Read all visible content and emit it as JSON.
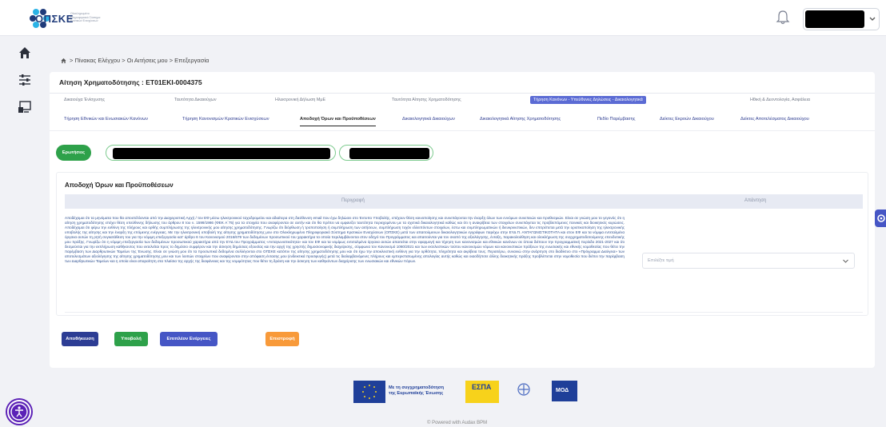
{
  "header": {
    "logo_text": "ΟΠΣΚΕ",
    "logo_subtitle": "Ολοκληρωμένο Πληροφοριακό Σύστημα Κρατικών Ενισχύσεων"
  },
  "breadcrumb": {
    "text": "> Πίνακας Ελέγχου > Οι Αιτήσεις μου > Επεξεργασία"
  },
  "application": {
    "title": "Αίτηση Χρηματοδότησης : ΕΤ01ΕΚΙ-0004375"
  },
  "tabs_level1": [
    "Δικαιούχα Ένίσχυσης",
    "Ταυτότητα Δικαιούχων",
    "Ηλεκτρονική Δήλωση ΜμΕ",
    "Ταυτότητα Αίτησης Χρηματοδότησης",
    "Τήρηση Κανόνων - Υπεύθυνες Δηλώσεις - Δικαιολογητικά",
    "Ηθική & Δεοντολογία, Ασφάλεια"
  ],
  "tabs_level2": [
    "Τήρηση Εθνικών και Ενωσιακών Κανόνων",
    "Τήρηση Κανονισμών Κρατικών Ενισχύσεων",
    "Αποδοχή Όρων και Προϋποθέσεων",
    "Δικαιολογητικά Δικαιούχων",
    "Δικαιολογητικά Αίτησης Χρηματοδότησης",
    "Πεδίο Παρέμβασης",
    "Δείκτες Εκροών Δικαιούχου",
    "Δείκτες Αποτελέσματος Δικαιούχου"
  ],
  "status": {
    "badge": "Ερωτήσεις"
  },
  "terms_section": {
    "title": "Αποδοχή Όρων και Προϋποθέσεων",
    "col_description": "Περιγραφή",
    "col_answer": "Απάντηση",
    "paragraph": "Αποδέχομαι ότι τα μηνύματα που θα αποστέλλονται από την Διαχειριστική Αρχή / τον ΕΦ μέσω ηλεκτρονικού ταχυδρομείου και αδιαίτερα στη διεύθυνση email που έχω δηλώσει στο Έντυπο Υποβολής, επέχουν θέση κοινοποίησης και συνεπάγονται την έναρξη όλων των εννόμων συνεπειών και προθεσμιών. Είναι σε γνώση μου το γεγονός ότι η αίτηση χρηματοδότησης επέχει θέση υπεύθυνης δήλωσης του άρθρου 8 του ν. 1599/1986 (ΦΕΚ Α΄75) για τα στοιχεία που αναφέρονται σε αυτήν και ότι θα πρέπει να εμφανίζει ταυτότητα περιεχομένου με τα σχετικά δικαιολογητικά καθώς και ότι η ανακρίβεια των στοιχείων συνεπάγεται τις προβλεπόμενες ποινικές και διοικητικές κυρώσεις. Αποδέχομαι ότι φέρω την ευθύνη της πλήρους και ορθής συμπλήρωσης της ηλεκτρονικής μου αίτησης χρηματοδότησης. Γνωρίζω ότι διόρθωση ή τροποποίηση ή συμπλήρωση των αιτήσεων, συμπλήρωση τυχόν ελλειπόντων στοιχείων, έστω και συμπληρωματικών ή διευκρινιστικών, δεν επιτρέπεται μετά την οριστικοποίηση της ηλεκτρονικής υποβολής της αίτησης και την έναρξη της επόμενης ενέργειας. Με την ηλεκτρονική υποβολή της αίτησης χρηματοδότησης μου στο Ολοκληρωμένο Πληροφοριακό Σύστημα Κρατικών Ενισχύσεων (ΟΠΣΚΕ) μετά των απαιτούμενων δικαιολογητικών εγγράφων παρέχω στην ΕΥΔ Π. ΑΝΤΑΓΩΝΙΣΤΙΚΟΤΗΤΑ και στον ΕΦ και τα νόμιμα εντεταλμένα όργανα αυτών τη ρητή συγκατάθεση του για την νόμιμη επεξεργασία κατ' άρθρο 6 του Κανονισμού 2016/679 των δεδομένων προσωπικού του χαρακτήρα τα οποία περιλαμβάνονται στον οδηγό του Προγράμματος και απαιτούνται για τον σκοπό της αξιολόγησης, ένταξη, παρακολούθηση και ολοκλήρωση της συγχρηματοδοτούμενης επενδυτικής μου πράξης. Γνωρίζω ότι η νόμιμη επεξεργασία των δεδομένων προσωπικού χαρακτήρα από την ΕΥΔ του Προγράμματος «Ανταγωνιστικότητα» και τον ΕΦ και τα νομίμως εντεταλμένα όργανα αυτών απαιτείται στην εφαρμογή και τήρηση των κανονισμών και εθνικών κανόνων σε όποια διέπουν την προγραμματική περίοδο 2021-2027 και ότι δεσμεύεται για την εκπλήρωση καθήκοντος που εκτελείται προς το δημόσιο συμφέρον και την άσκηση δημόσιας εξουσίας και την αρχή της χρηστής δημοσιονομικής διαχείρισης, σύμφωνα τον Κανονισμό 1060/2021 και των εκτελεστικών τούτου κανονισμών νόμων και κανονιστικών πράξεων της ενωσιακής και εθνικής νομοθεσίας που θέτει την παρέμβαση των Διαρθρωτικών Ταμείων της Ένωσης. Είναι σε γνώση μου ότι τα προσωπικά δεδομένα συλλέγονται στο ΟΠΣΚΕ κατόπιν της αίτησης χρηματοδότησης μου και ότι έχω την αποκλειστική ευθύνη για την ορθότητα, πληρότητα και ακρίβεια τους. Περαιτέρω, συναινώ στην ανάρτηση στο διαδίκτυο στο «Πρόγραμμα Διαύγεια» των αποτελεσμάτων αξιολόγησης της αίτησης χρηματοδότησης μου και των λοιπών στοιχείων που αναφέρονται στην απόφαση έντασης μου (ενδεικτικά προσφυγής) μετά τις διαλαμβανόμενες πλήρους και εμπεριστατωμένης απολογίας αυτής καθώς και οιασδήποτε άλλης διοικητικής πράξης προβλέπεται στην νομοθεσία που διέπει την παρέμβαση των Διαρθρωτικών Ταμείων και η οποία είναι απαραίτητη στα πλαίσια της αρχής της διαφάνειας και της νομιμότητας που θέτει τη δράση και την άσκηση των καθηκόντων διαχείρισης των ενωσιακών και εθνικών πόρων.",
    "answer_placeholder": "Επιλέξτε τιμή"
  },
  "actions": {
    "save": "Αποθήκευση",
    "submit": "Υποβολή",
    "more": "Επιπλέον Ενέργειες",
    "back": "Επιστροφή"
  },
  "footer": {
    "eu_text": "Με τη συγχρηματοδότηση της Ευρωπαϊκής Ένωσης",
    "espa_text": "ΕΣΠΑ",
    "moa_text": "ΜΟΔ",
    "copyright": "© Powered with Audax BPM"
  },
  "icons": [
    "home-icon",
    "sliders-icon",
    "screen-icon",
    "bell-icon",
    "chevron-down-icon",
    "gear-icon",
    "accessibility-icon"
  ],
  "colors": {
    "primary": "#2d3d94",
    "green": "#2ea14a",
    "orange": "#f89a3a",
    "active_tab": "#5b6bd4"
  }
}
